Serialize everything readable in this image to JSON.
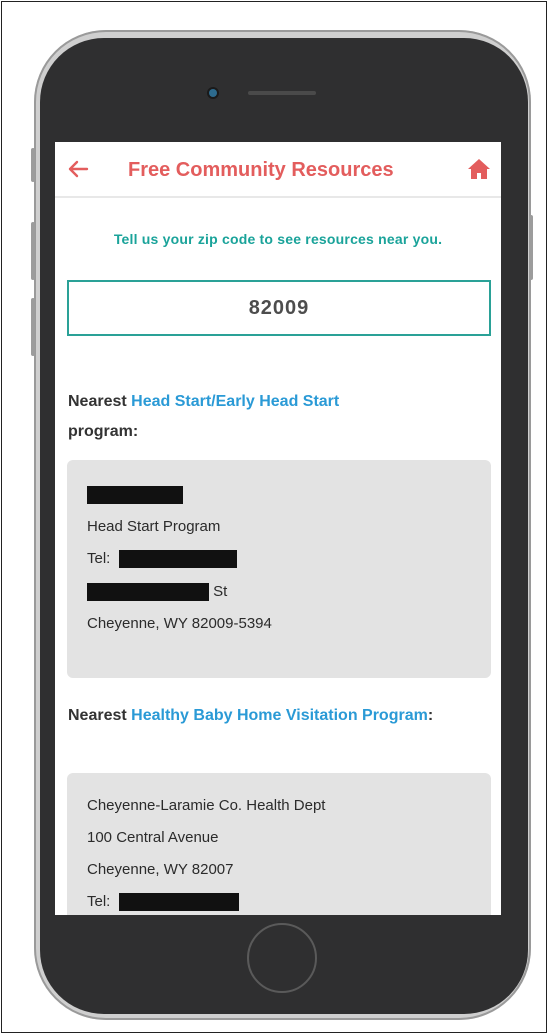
{
  "header": {
    "title": "Free Community Resources",
    "back_icon": "left-arrow-icon",
    "home_icon": "house-icon",
    "accent_color": "#e35d5d"
  },
  "zip_prompt": "Tell us your zip code to see resources near you.",
  "zip_input": {
    "value": "82009",
    "border_color": "#2aa197"
  },
  "sections": [
    {
      "prefix": "Nearest ",
      "link_text": "Head Start/Early Head Start",
      "suffix": " program:",
      "card_lines": {
        "program": "Head Start Program",
        "tel_label": "Tel:",
        "street_suffix": "St",
        "city": "Cheyenne, WY 82009-5394"
      }
    },
    {
      "prefix": "Nearest ",
      "link_text": "Healthy Baby Home Visitation Program",
      "suffix": ":",
      "card_lines": {
        "name": "Cheyenne-Laramie Co. Health Dept",
        "street": "100 Central Avenue",
        "city": "Cheyenne, WY 82007",
        "tel_label": "Tel:"
      }
    }
  ],
  "colors": {
    "link": "#2a9ad6",
    "card_bg": "#e3e3e3",
    "prompt": "#1aa39a"
  }
}
